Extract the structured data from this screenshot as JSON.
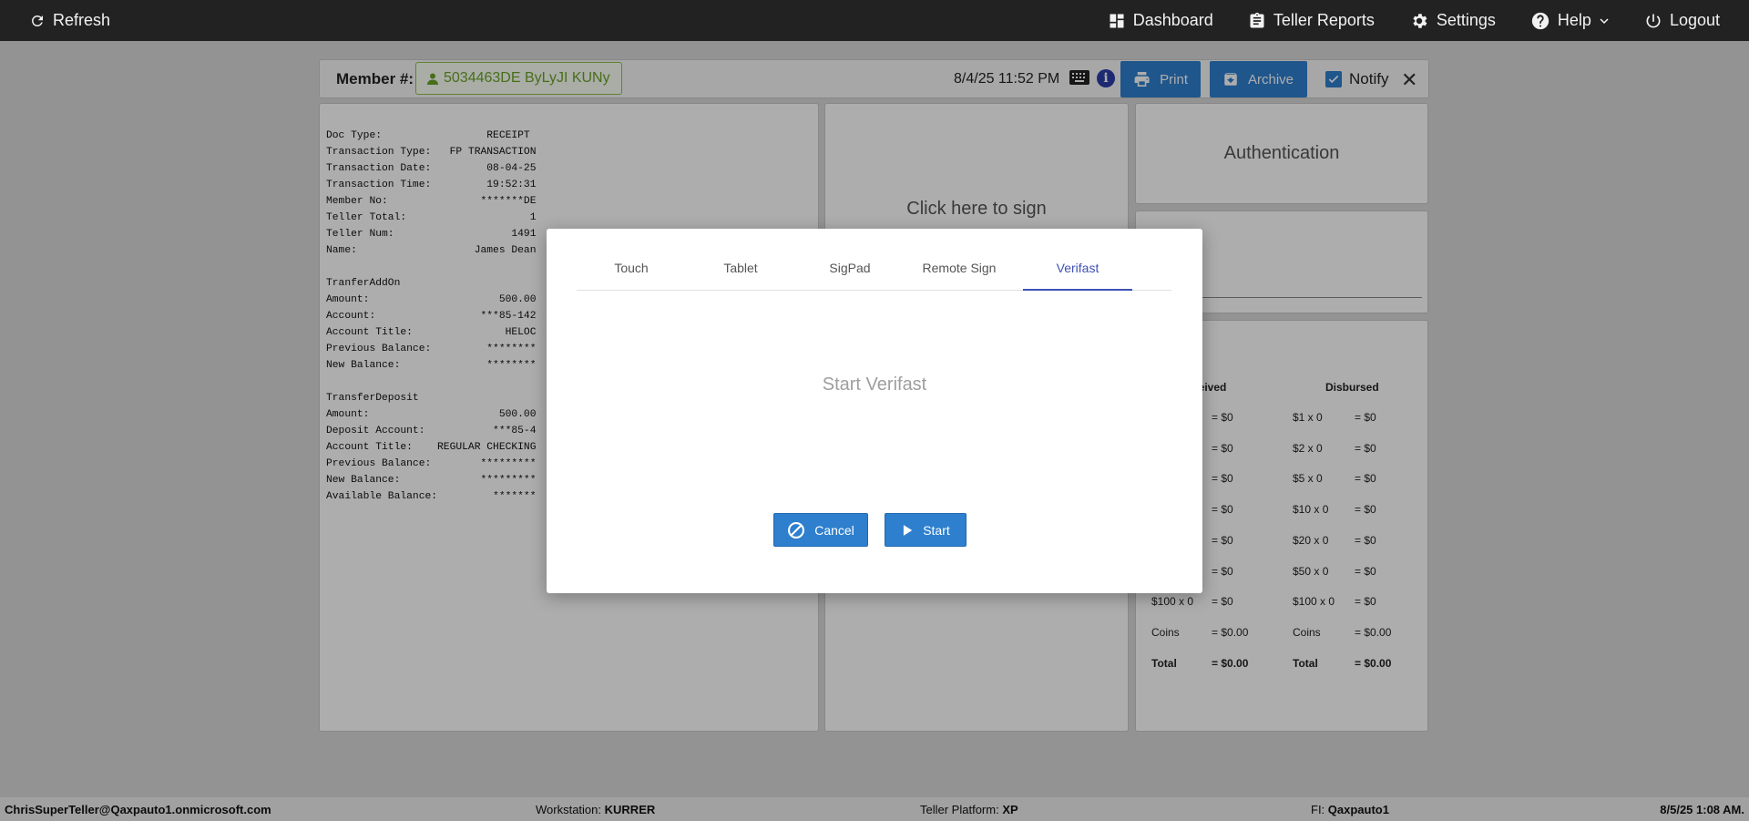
{
  "topbar": {
    "refresh": "Refresh",
    "dashboard": "Dashboard",
    "teller_reports": "Teller Reports",
    "settings": "Settings",
    "help": "Help",
    "logout": "Logout"
  },
  "header": {
    "member_label": "Member #:",
    "member_value": "5034463DE ByLyJI KUNy",
    "datetime": "8/4/25 11:52 PM",
    "print": "Print",
    "archive": "Archive",
    "notify": "Notify"
  },
  "receipt": {
    "text": "Doc Type:                 RECEIPT\nTransaction Type:   FP TRANSACTION\nTransaction Date:         08-04-25\nTransaction Time:         19:52:31\nMember No:               *******DE\nTeller Total:                    1\nTeller Num:                   1491\nName:                   James Dean\n\nTranferAddOn\nAmount:                     500.00\nAccount:                 ***85-142\nAccount Title:               HELOC\nPrevious Balance:         ********\nNew Balance:              ********\n\nTransferDeposit\nAmount:                     500.00\nDeposit Account:           ***85-4\nAccount Title:    REGULAR CHECKING\nPrevious Balance:        *********\nNew Balance:             *********\nAvailable Balance:         *******"
  },
  "signature": {
    "prompt": "Click here to sign"
  },
  "auth": {
    "label": "Authentication"
  },
  "cash": {
    "received_header": "ceived",
    "disbursed_header": "Disbursed",
    "received": [
      {
        "label": "",
        "amount": "= $0"
      },
      {
        "label": "",
        "amount": "= $0"
      },
      {
        "label": "",
        "amount": "= $0"
      },
      {
        "label": "",
        "amount": "= $0"
      },
      {
        "label": "",
        "amount": "= $0"
      },
      {
        "label": "",
        "amount": "= $0"
      },
      {
        "label": "$100 x 0",
        "amount": "= $0"
      },
      {
        "label": "Coins",
        "amount": "= $0.00"
      },
      {
        "label": "Total",
        "amount": "= $0.00"
      }
    ],
    "disbursed": [
      {
        "label": "$1 x 0",
        "amount": "= $0"
      },
      {
        "label": "$2 x 0",
        "amount": "= $0"
      },
      {
        "label": "$5 x 0",
        "amount": "= $0"
      },
      {
        "label": "$10 x 0",
        "amount": "= $0"
      },
      {
        "label": "$20 x 0",
        "amount": "= $0"
      },
      {
        "label": "$50 x 0",
        "amount": "= $0"
      },
      {
        "label": "$100 x 0",
        "amount": "= $0"
      },
      {
        "label": "Coins",
        "amount": "= $0.00"
      },
      {
        "label": "Total",
        "amount": "= $0.00"
      }
    ]
  },
  "modal": {
    "tabs": [
      "Touch",
      "Tablet",
      "SigPad",
      "Remote Sign",
      "Verifast"
    ],
    "active_tab": "Verifast",
    "message": "Start Verifast",
    "cancel": "Cancel",
    "start": "Start"
  },
  "status": {
    "user": "ChrisSuperTeller@Qaxpauto1.onmicrosoft.com",
    "workstation_label": "Workstation:",
    "workstation_value": "KURRER",
    "platform_label": "Teller Platform:",
    "platform_value": "XP",
    "fi_label": "FI:",
    "fi_value": "Qaxpauto1",
    "time": "8/5/25 1:08 AM."
  }
}
